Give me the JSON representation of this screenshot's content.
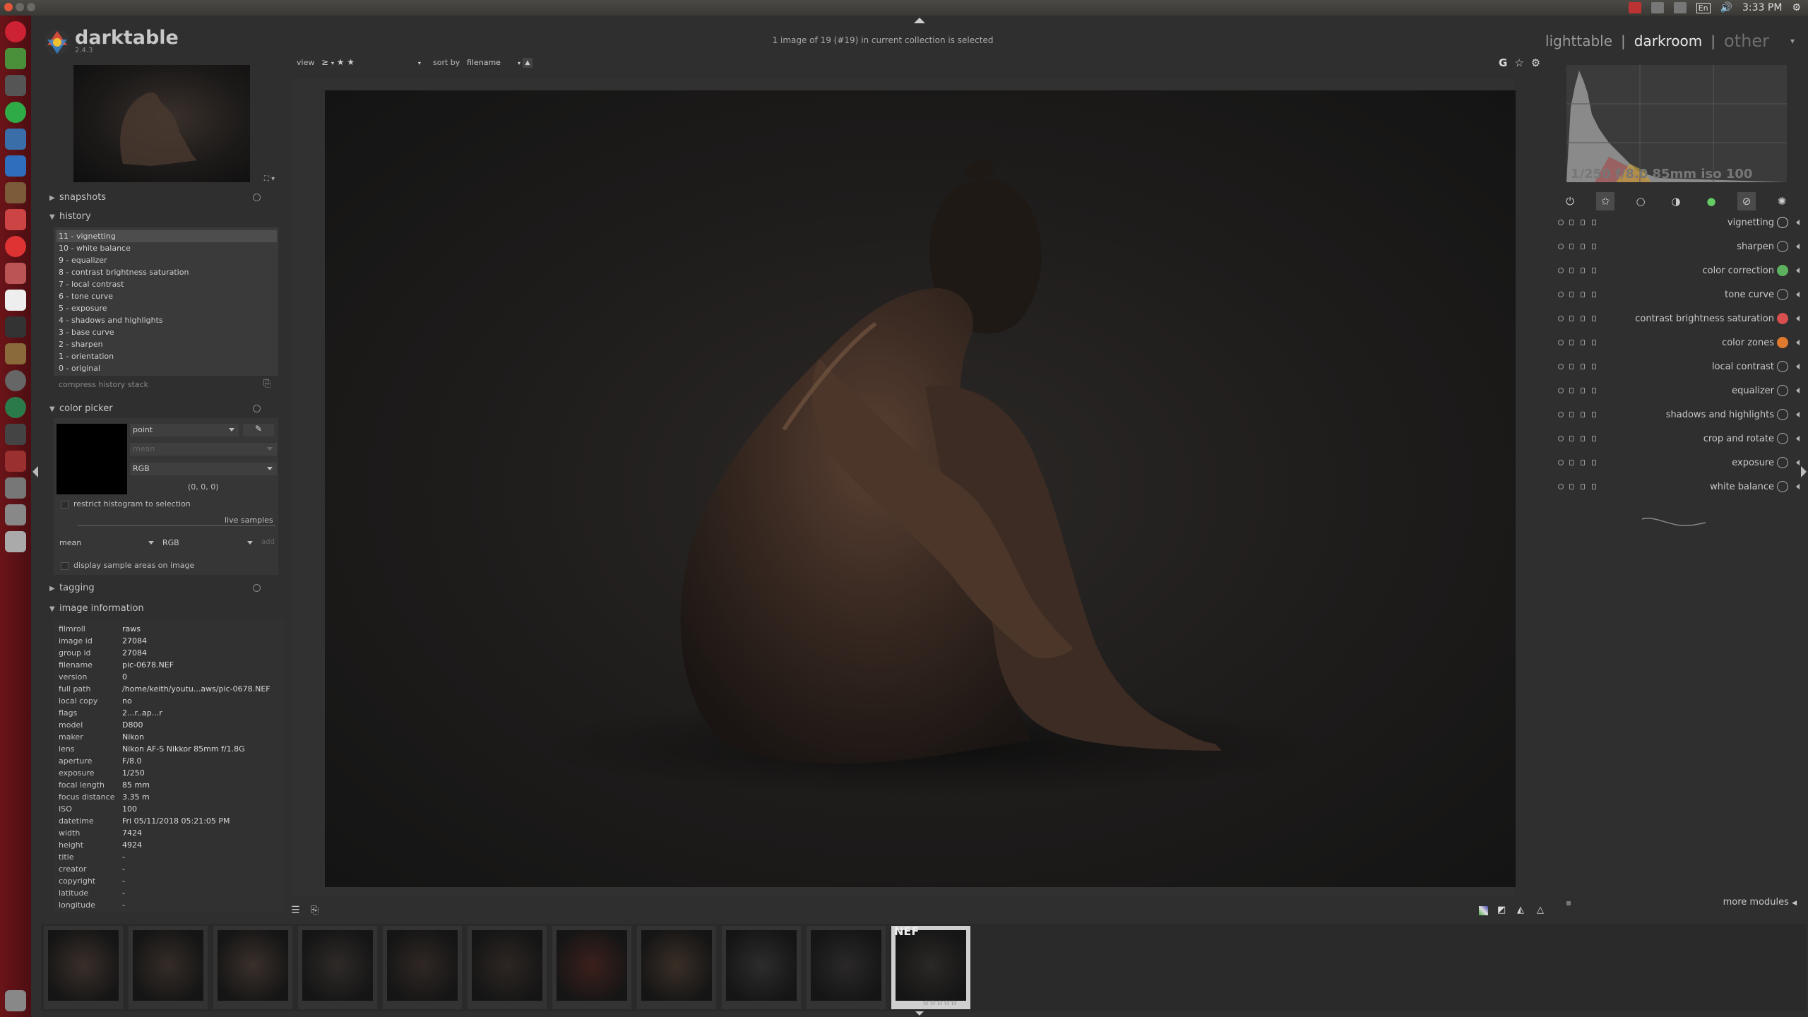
{
  "system": {
    "time": "3:33 PM",
    "keyboard": "En"
  },
  "app": {
    "name": "darktable",
    "version": "2.4.3",
    "collection_status": "1 image of 19 (#19) in current collection is selected"
  },
  "views": [
    "lighttable",
    "darkroom",
    "other"
  ],
  "view_separator": "|",
  "filter": {
    "view_label": "view",
    "rating_op": "≥",
    "rating_stars": "★ ★",
    "sort_label": "sort by",
    "sort_value": "filename",
    "sort_dir": "▲"
  },
  "top_icons": [
    "G",
    "☆",
    "⚙"
  ],
  "left": {
    "snapshots": "snapshots",
    "history": "history",
    "history_items": [
      "11 - vignetting",
      "10 - white balance",
      "9 - equalizer",
      "8 - contrast brightness saturation",
      "7 - local contrast",
      "6 - tone curve",
      "5 - exposure",
      "4 - shadows and highlights",
      "3 - base curve",
      "2 - sharpen",
      "1 - orientation",
      "0 - original"
    ],
    "compress_history": "compress history stack",
    "color_picker": "color picker",
    "picker_mode": "point",
    "picker_stat": "mean",
    "picker_space": "RGB",
    "picker_values": "(0, 0, 0)",
    "restrict_histogram": "restrict histogram to selection",
    "live_samples": "live samples",
    "sample_stat": "mean",
    "sample_space": "RGB",
    "add": "add",
    "display_sample_areas": "display sample areas on image",
    "tagging": "tagging",
    "image_information": "image information",
    "info": [
      {
        "k": "filmroll",
        "v": "raws"
      },
      {
        "k": "image id",
        "v": "27084"
      },
      {
        "k": "group id",
        "v": "27084"
      },
      {
        "k": "filename",
        "v": "pic-0678.NEF"
      },
      {
        "k": "version",
        "v": "0"
      },
      {
        "k": "full path",
        "v": "/home/keith/youtu...aws/pic-0678.NEF"
      },
      {
        "k": "local copy",
        "v": "no"
      },
      {
        "k": "flags",
        "v": "2...r..ap...r"
      },
      {
        "k": "model",
        "v": "D800"
      },
      {
        "k": "maker",
        "v": "Nikon"
      },
      {
        "k": "lens",
        "v": "Nikon AF-S Nikkor 85mm f/1.8G"
      },
      {
        "k": "aperture",
        "v": "F/8.0"
      },
      {
        "k": "exposure",
        "v": "1/250"
      },
      {
        "k": "focal length",
        "v": "85 mm"
      },
      {
        "k": "focus distance",
        "v": "3.35 m"
      },
      {
        "k": "ISO",
        "v": "100"
      },
      {
        "k": "datetime",
        "v": "Fri 05/11/2018 05:21:05 PM"
      },
      {
        "k": "width",
        "v": "7424"
      },
      {
        "k": "height",
        "v": "4924"
      },
      {
        "k": "title",
        "v": "-"
      },
      {
        "k": "creator",
        "v": "-"
      },
      {
        "k": "copyright",
        "v": "-"
      },
      {
        "k": "latitude",
        "v": "-"
      },
      {
        "k": "longitude",
        "v": "-"
      }
    ]
  },
  "right": {
    "exif_summary": "1/250 f/8.0 85mm iso 100",
    "groups": [
      "power-icon",
      "star-icon",
      "circle-icon",
      "half-circle-icon",
      "color-icon",
      "correct-icon",
      "effect-icon"
    ],
    "modules": [
      {
        "name": "vignetting",
        "icon": "vignette-icon",
        "color": "#cccccc"
      },
      {
        "name": "sharpen",
        "icon": "sharpen-icon",
        "color": "#aaaaaa"
      },
      {
        "name": "color correction",
        "icon": "color-correction-icon",
        "color": "#5db05d"
      },
      {
        "name": "tone curve",
        "icon": "tone-curve-icon",
        "color": "#aaaaaa"
      },
      {
        "name": "contrast brightness saturation",
        "icon": "cbs-icon",
        "color": "#d84f4f"
      },
      {
        "name": "color zones",
        "icon": "color-zones-icon",
        "color": "#e07a2e"
      },
      {
        "name": "local contrast",
        "icon": "local-contrast-icon",
        "color": "#aaaaaa"
      },
      {
        "name": "equalizer",
        "icon": "equalizer-icon",
        "color": "#aaaaaa"
      },
      {
        "name": "shadows and highlights",
        "icon": "shadows-highlights-icon",
        "color": "#aaaaaa"
      },
      {
        "name": "crop and rotate",
        "icon": "crop-icon",
        "color": "#aaaaaa"
      },
      {
        "name": "exposure",
        "icon": "exposure-icon",
        "color": "#aaaaaa"
      },
      {
        "name": "white balance",
        "icon": "white-balance-icon",
        "color": "#aaaaaa"
      }
    ],
    "more_modules": "more modules"
  },
  "filmstrip": {
    "count": 11,
    "selected_index": 10,
    "nef_label": "NEF",
    "stars": "☆☆☆☆☆"
  }
}
